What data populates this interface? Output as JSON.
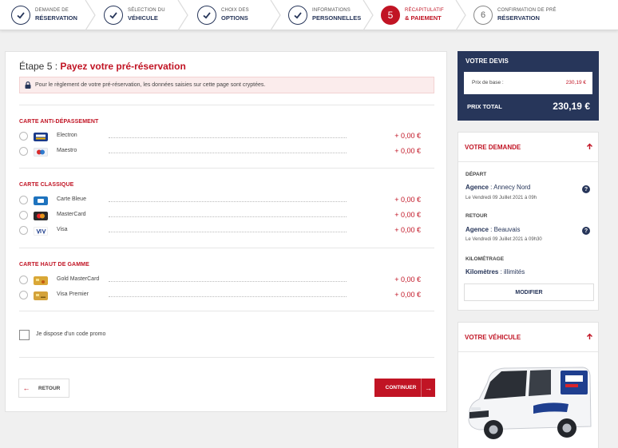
{
  "steps": [
    {
      "line1": "DEMANDE DE",
      "line2": "RÉSERVATION",
      "state": "done"
    },
    {
      "line1": "SÉLECTION DU",
      "line2": "VÉHICULE",
      "state": "done"
    },
    {
      "line1": "CHOIX DES",
      "line2": "OPTIONS",
      "state": "done"
    },
    {
      "line1": "INFORMATIONS",
      "line2": "PERSONNELLES",
      "state": "done"
    },
    {
      "number": "5",
      "line1": "RÉCAPITULATIF",
      "line2": "& PAIEMENT",
      "state": "active"
    },
    {
      "number": "6",
      "line1": "CONFIRMATION DE PRÉ",
      "line2": "RÉSERVATION",
      "state": "todo"
    }
  ],
  "main": {
    "title_prefix": "Étape 5 : ",
    "title_highlight": "Payez votre pré-réservation",
    "notice": "Pour le règlement de votre pré-réservation, les données saisies sur cette page sont cryptées.",
    "sections": [
      {
        "title": "CARTE ANTI-DÉPASSEMENT",
        "options": [
          {
            "label": "Electron",
            "price": "+ 0,00 €",
            "logo": "visa-electron"
          },
          {
            "label": "Maestro",
            "price": "+ 0,00 €",
            "logo": "maestro"
          }
        ]
      },
      {
        "title": "CARTE CLASSIQUE",
        "options": [
          {
            "label": "Carte Bleue",
            "price": "+ 0,00 €",
            "logo": "cb"
          },
          {
            "label": "MasterCard",
            "price": "+ 0,00 €",
            "logo": "mastercard"
          },
          {
            "label": "Visa",
            "price": "+ 0,00 €",
            "logo": "visa"
          }
        ]
      },
      {
        "title": "CARTE HAUT DE GAMME",
        "options": [
          {
            "label": "Gold MasterCard",
            "price": "+ 0,00 €",
            "logo": "gold-mastercard"
          },
          {
            "label": "Visa Premier",
            "price": "+ 0,00 €",
            "logo": "visa-premier"
          }
        ]
      }
    ],
    "promo_label": "Je dispose d'un code promo",
    "back_label": "RETOUR",
    "continue_label": "CONTINUER"
  },
  "devis": {
    "title": "VOTRE DEVIS",
    "base_label": "Prix de base :",
    "base_value": "230,19 €",
    "total_label": "PRIX TOTAL",
    "total_value": "230,19 €"
  },
  "demande": {
    "title": "VOTRE DEMANDE",
    "depart_label": "DÉPART",
    "depart_agency_label": "Agence",
    "depart_agency": " : Annecy Nord",
    "depart_date": "Le Vendredi 09 Juillet 2021 à 09h",
    "retour_label": "RETOUR",
    "retour_agency_label": "Agence",
    "retour_agency": " : Beauvais",
    "retour_date": "Le Vendredi 09 Juillet 2021 à 09h30",
    "km_label": "KILOMÉTRAGE",
    "km_key": "Kilomètres",
    "km_value": " : illimités",
    "modify_label": "MODIFIER"
  },
  "vehicule": {
    "title": "VOTRE VÉHICULE"
  },
  "colors": {
    "accent": "#c11424",
    "navy": "#27365a"
  }
}
